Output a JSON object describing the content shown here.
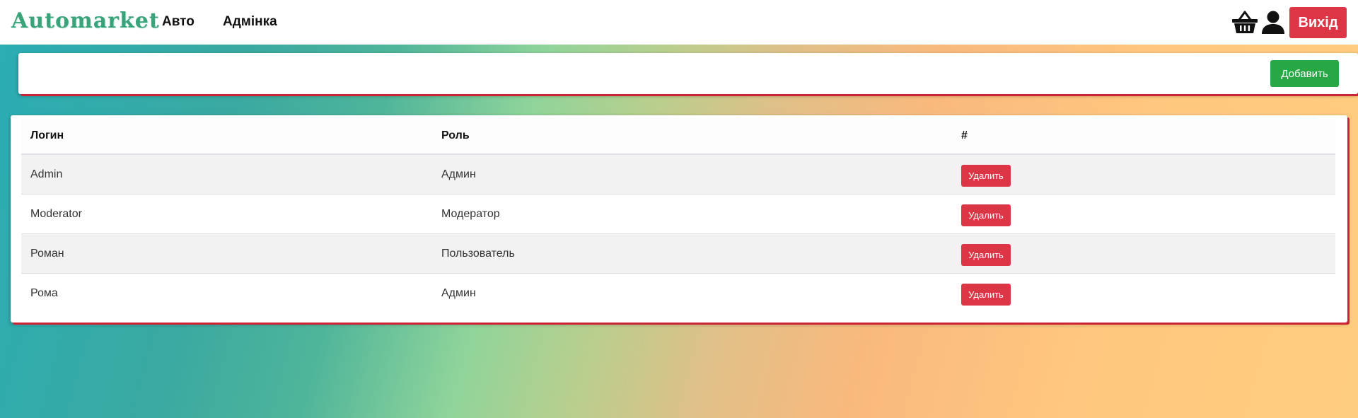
{
  "navbar": {
    "brand": "Automarket",
    "links": [
      "Авто",
      "Адмінка"
    ],
    "cart_icon": "basket-icon",
    "user_icon": "user-icon",
    "logout_label": "Вихід"
  },
  "toolbar": {
    "add_label": "Добавить"
  },
  "table": {
    "headers": [
      "Логин",
      "Роль",
      "#"
    ],
    "rows": [
      {
        "login": "Admin",
        "role": "Админ",
        "action": "Удалить"
      },
      {
        "login": "Moderator",
        "role": "Модератор",
        "action": "Удалить"
      },
      {
        "login": "Роман",
        "role": "Пользователь",
        "action": "Удалить"
      },
      {
        "login": "Рома",
        "role": "Админ",
        "action": "Удалить"
      }
    ]
  },
  "colors": {
    "brand": "#3aa37a",
    "danger": "#dc3545",
    "success": "#28a745"
  }
}
